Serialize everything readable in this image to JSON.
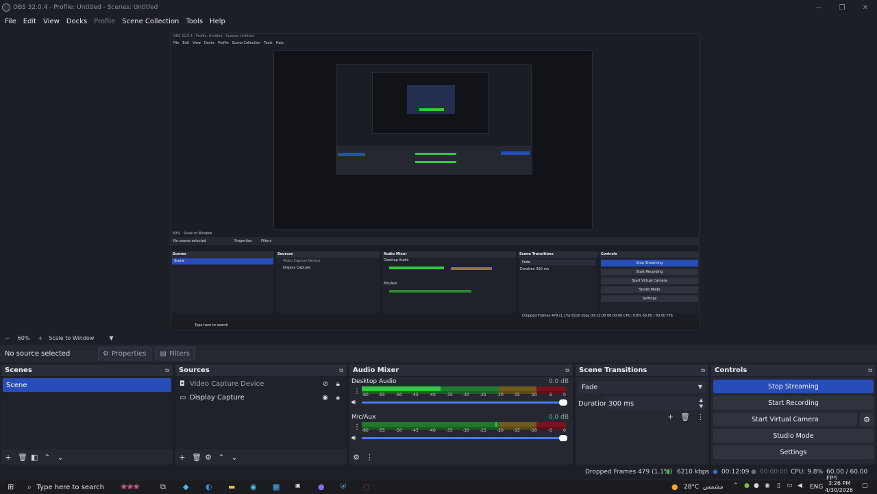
{
  "window": {
    "title": "OBS 32.0.4 - Profile: Untitled - Scenes: Untitled",
    "minimize": "—",
    "maximize": "❐",
    "close": "✕"
  },
  "menu": {
    "file": "File",
    "edit": "Edit",
    "view": "View",
    "docks": "Docks",
    "profile": "Profile",
    "scene_collection": "Scene Collection",
    "tools": "Tools",
    "help": "Help"
  },
  "preview": {
    "nested_title": "OBS 32.0.4 - Profile: Untitled - Scenes: Untitled",
    "nested_menu": [
      "File",
      "Edit",
      "View",
      "Docks",
      "Profile",
      "Scene Collection",
      "Tools",
      "Help"
    ],
    "nested_no_source": "No source selected",
    "nested_properties": "Properties",
    "nested_filters": "Filters",
    "nested_scenes": "Scenes",
    "nested_scene": "Scene",
    "nested_sources": "Sources",
    "nested_src1": "Video Capture Device",
    "nested_src2": "Display Capture",
    "nested_mixer": "Audio Mixer",
    "nested_desktop": "Desktop Audio",
    "nested_mic": "Mic/Aux",
    "nested_transitions": "Scene Transitions",
    "nested_fade": "Fade",
    "nested_duration": "Duration",
    "nested_duration_value": "300 ms",
    "nested_controls": "Controls",
    "nested_ctl": [
      "Stop Streaming",
      "Start Recording",
      "Start Virtual Camera",
      "Studio Mode",
      "Settings"
    ],
    "nested_zoom": "60%",
    "nested_scale": "Scale to Window",
    "nested_status": "Dropped Frames 479 (1.1%)   6210 kbps   00:12:08   00:00:00   CPU: 9.8%   60.00 / 60.00 FPS",
    "nested_search": "Type here to search"
  },
  "zoom": {
    "minus": "−",
    "value": "60%",
    "plus": "+",
    "scale_mode": "Scale to Window",
    "dropdown": "▼"
  },
  "context": {
    "no_source": "No source selected",
    "properties": "Properties",
    "filters": "Filters"
  },
  "scenes": {
    "title": "Scenes",
    "items": [
      "Scene"
    ]
  },
  "sources": {
    "title": "Sources",
    "items": [
      {
        "label": "Video Capture Device",
        "icon": "camera-icon",
        "hidden": true
      },
      {
        "label": "Display Capture",
        "icon": "monitor-icon",
        "hidden": false
      }
    ]
  },
  "mixer": {
    "title": "Audio Mixer",
    "channels": [
      {
        "name": "Desktop Audio",
        "db": "0.0 dB"
      },
      {
        "name": "Mic/Aux",
        "db": "0.0 dB"
      }
    ],
    "ticks": [
      "-60",
      "-55",
      "-50",
      "-45",
      "-40",
      "-35",
      "-30",
      "-25",
      "-20",
      "-15",
      "-10",
      "-5",
      "0"
    ]
  },
  "transitions": {
    "title": "Scene Transitions",
    "selected": "Fade",
    "duration_label": "Duration",
    "duration_value": "300 ms"
  },
  "controls": {
    "title": "Controls",
    "stop_streaming": "Stop Streaming",
    "start_recording": "Start Recording",
    "start_virtual_camera": "Start Virtual Camera",
    "studio_mode": "Studio Mode",
    "settings": "Settings"
  },
  "status": {
    "dropped_frames": "Dropped Frames 479 (1.1%)",
    "bitrate": "6210 kbps",
    "stream_time": "00:12:09",
    "record_time": "00:00:00",
    "cpu": "CPU: 9.8%",
    "fps": "60.00 / 60.00 FPS"
  },
  "taskbar": {
    "search_placeholder": "Type here to search",
    "weather": "28°C",
    "weather_text": "مشمس",
    "lang": "ENG",
    "time": "3:26 PM",
    "date": "4/30/2026"
  },
  "colors": {
    "accent": "#284cb8",
    "meter_green": "#2ecc40",
    "meter_yellow": "#c9a227",
    "meter_red": "#b3152a"
  }
}
